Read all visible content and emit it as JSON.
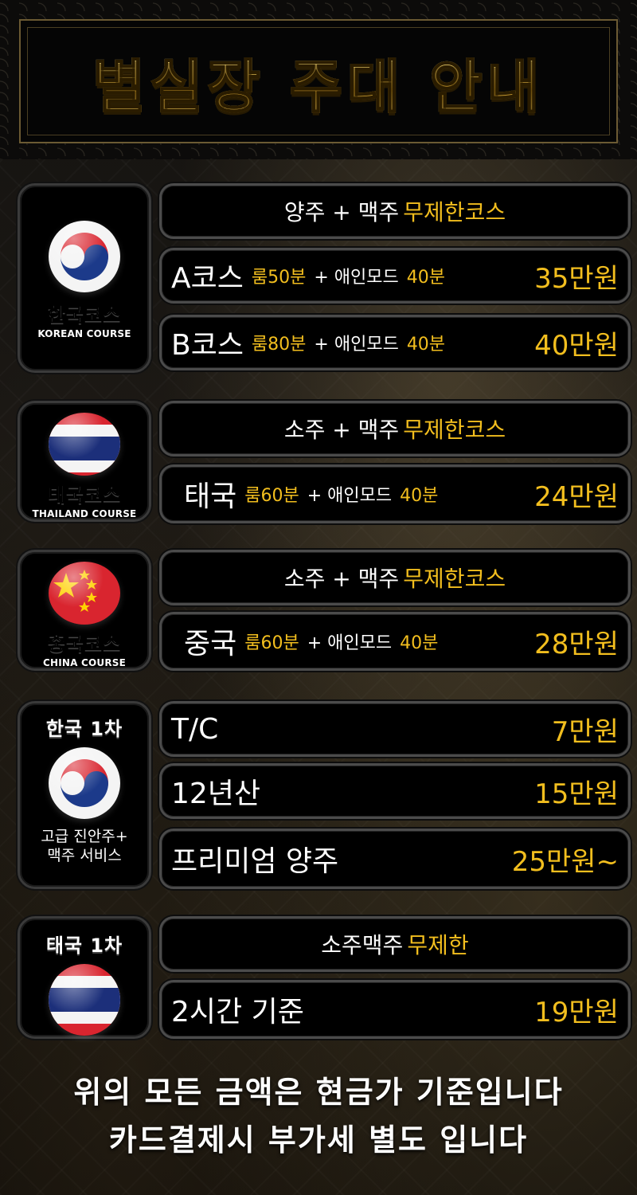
{
  "title": "별실장 주대 안내",
  "sections": {
    "korean_course": {
      "badge_title": "한국코스",
      "badge_sub": "KOREAN COURSE",
      "header": {
        "white": "양주 + 맥주",
        "gold": "무제한코스"
      },
      "rows": [
        {
          "name": "A코스",
          "room": "룸50분",
          "plus": "+ 애인모드",
          "time": "40분",
          "price": "35만원"
        },
        {
          "name": "B코스",
          "room": "룸80분",
          "plus": "+ 애인모드",
          "time": "40분",
          "price": "40만원"
        }
      ]
    },
    "thailand_course": {
      "badge_title": "태국코스",
      "badge_sub": "THAILAND COURSE",
      "header": {
        "white": "소주 + 맥주",
        "gold": "무제한코스"
      },
      "rows": [
        {
          "name": "태국",
          "room": "룸60분",
          "plus": "+ 애인모드",
          "time": "40분",
          "price": "24만원"
        }
      ]
    },
    "china_course": {
      "badge_title": "중국코스",
      "badge_sub": "CHINA COURSE",
      "header": {
        "white": "소주 + 맥주",
        "gold": "무제한코스"
      },
      "rows": [
        {
          "name": "중국",
          "room": "룸60분",
          "plus": "+ 애인모드",
          "time": "40분",
          "price": "28만원"
        }
      ]
    },
    "korea_first": {
      "badge_title": "한국 1차",
      "badge_desc_line1": "고급 진안주+",
      "badge_desc_line2": "맥주 서비스",
      "rows": [
        {
          "name": "T/C",
          "price": "7만원"
        },
        {
          "name": "12년산",
          "price": "15만원"
        },
        {
          "name": "프리미엄 양주",
          "price": "25만원~"
        }
      ]
    },
    "thai_first": {
      "badge_title": "태국 1차",
      "header": {
        "white": "소주맥주",
        "gold": "무제한"
      },
      "rows": [
        {
          "name": "2시간 기준",
          "price": "19만원"
        }
      ]
    }
  },
  "footer": {
    "line1": "위의 모든 금액은 현금가 기준입니다",
    "line2": "카드결제시 부가세 별도 입니다"
  },
  "colors": {
    "gold": "#f2be1e",
    "white": "#ffffff",
    "background": "#0b0a08"
  },
  "icons": [
    "korea-flag-icon",
    "thailand-flag-icon",
    "china-flag-icon"
  ]
}
